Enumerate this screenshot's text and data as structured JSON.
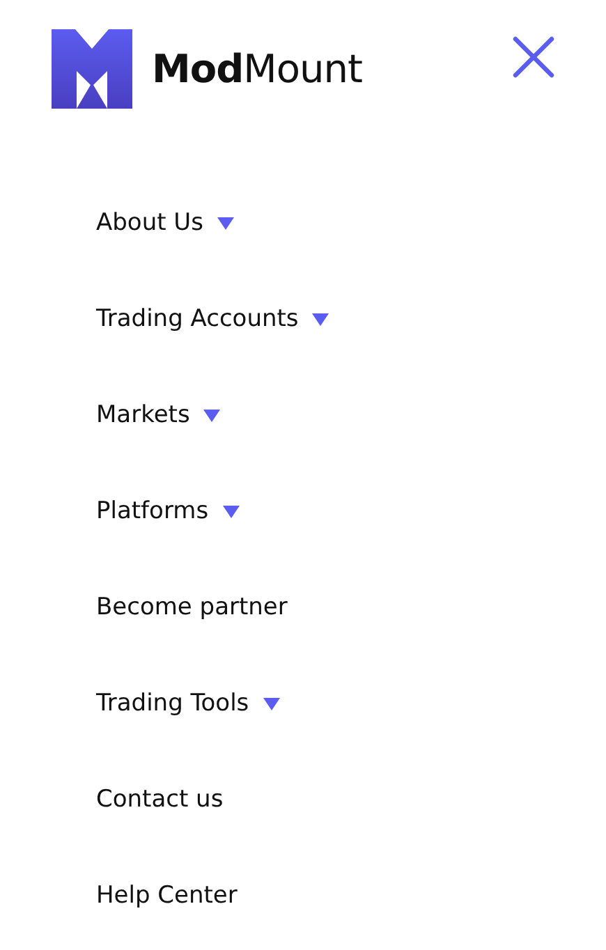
{
  "header": {
    "logo_text": "**Mod**Mount"
  },
  "menu": [
    {
      "label": "About Us",
      "kind": "dropdown"
    },
    {
      "label": "Trading Accounts",
      "kind": "dropdown"
    },
    {
      "label": "Markets",
      "kind": "dropdown"
    },
    {
      "label": "Platforms",
      "kind": "dropdown"
    },
    {
      "label": "Become partner",
      "kind": "link"
    },
    {
      "label": "Trading Tools",
      "kind": "dropdown"
    },
    {
      "label": "Contact us",
      "kind": "link"
    },
    {
      "label": "Help Center",
      "kind": "link"
    }
  ]
}
